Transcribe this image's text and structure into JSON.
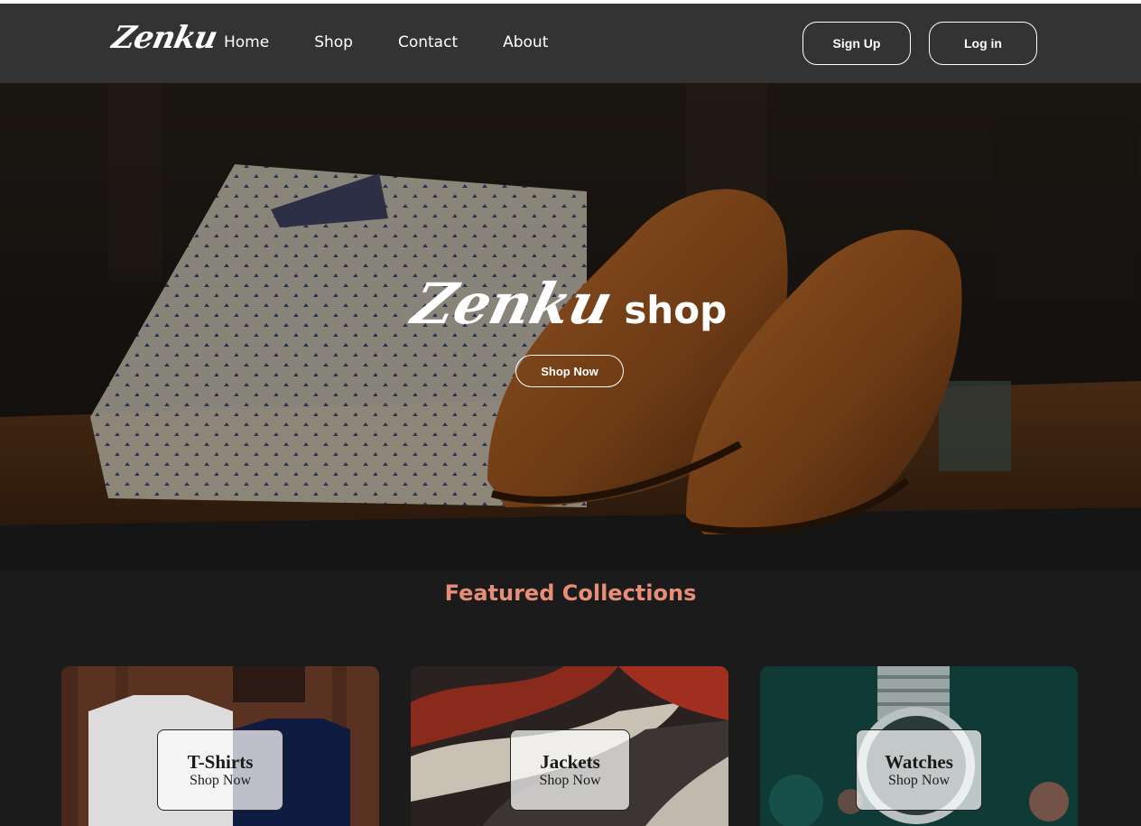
{
  "nav": {
    "logo": "Zenku",
    "links": [
      "Home",
      "Shop",
      "Contact",
      "About"
    ],
    "signup": "Sign Up",
    "login": "Log in"
  },
  "hero": {
    "brand": "Zenku",
    "word": "shop",
    "button": "Shop Now"
  },
  "featured": {
    "title": "Featured Collections",
    "cards": [
      {
        "name": "T-Shirts",
        "cta": "Shop Now"
      },
      {
        "name": "Jackets",
        "cta": "Shop Now"
      },
      {
        "name": "Watches",
        "cta": "Shop Now"
      }
    ]
  },
  "colors": {
    "navbar": "#333333",
    "page_bg": "#1b1b1b",
    "accent": "#e88e76"
  },
  "icons": {
    "hero": "shirts-and-shoes-photo",
    "card_1": "tshirts-photo",
    "card_2": "jackets-photo",
    "card_3": "watch-photo"
  }
}
